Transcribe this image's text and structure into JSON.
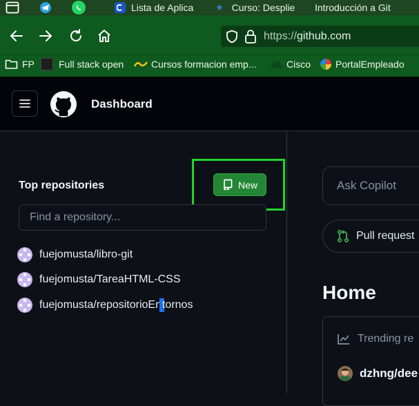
{
  "browser": {
    "tabs": [
      {
        "label": ""
      },
      {
        "label": ""
      },
      {
        "label": ""
      },
      {
        "label": "Lista de Aplica"
      },
      {
        "label": "Curso: Desplie"
      },
      {
        "label": "Introducción a Git"
      }
    ],
    "url_prefix": "https://",
    "url_domain": "github.com",
    "bookmarks": [
      "FP",
      "Full stack open",
      "Cursos formacion emp...",
      "Cisco",
      "PortalEmpleado"
    ]
  },
  "header": {
    "title": "Dashboard"
  },
  "sidebar": {
    "heading": "Top repositories",
    "new_button": "New",
    "search_placeholder": "Find a repository...",
    "repos": [
      {
        "name": "fuejomusta/libro-git"
      },
      {
        "name": "fuejomusta/TareaHTML-CSS"
      },
      {
        "name_before_cursor": "fuejomusta/repositorioEn",
        "name_after_cursor": "tornos"
      }
    ]
  },
  "main": {
    "copilot_placeholder": "Ask Copilot",
    "pull_requests_label": "Pull request",
    "home_title": "Home",
    "trending_label": "Trending re",
    "trending_user": "dzhng/dee"
  },
  "colors": {
    "accent_green": "#238636",
    "highlight": "#22d32a",
    "browser_chrome": "#0f5a1e"
  }
}
